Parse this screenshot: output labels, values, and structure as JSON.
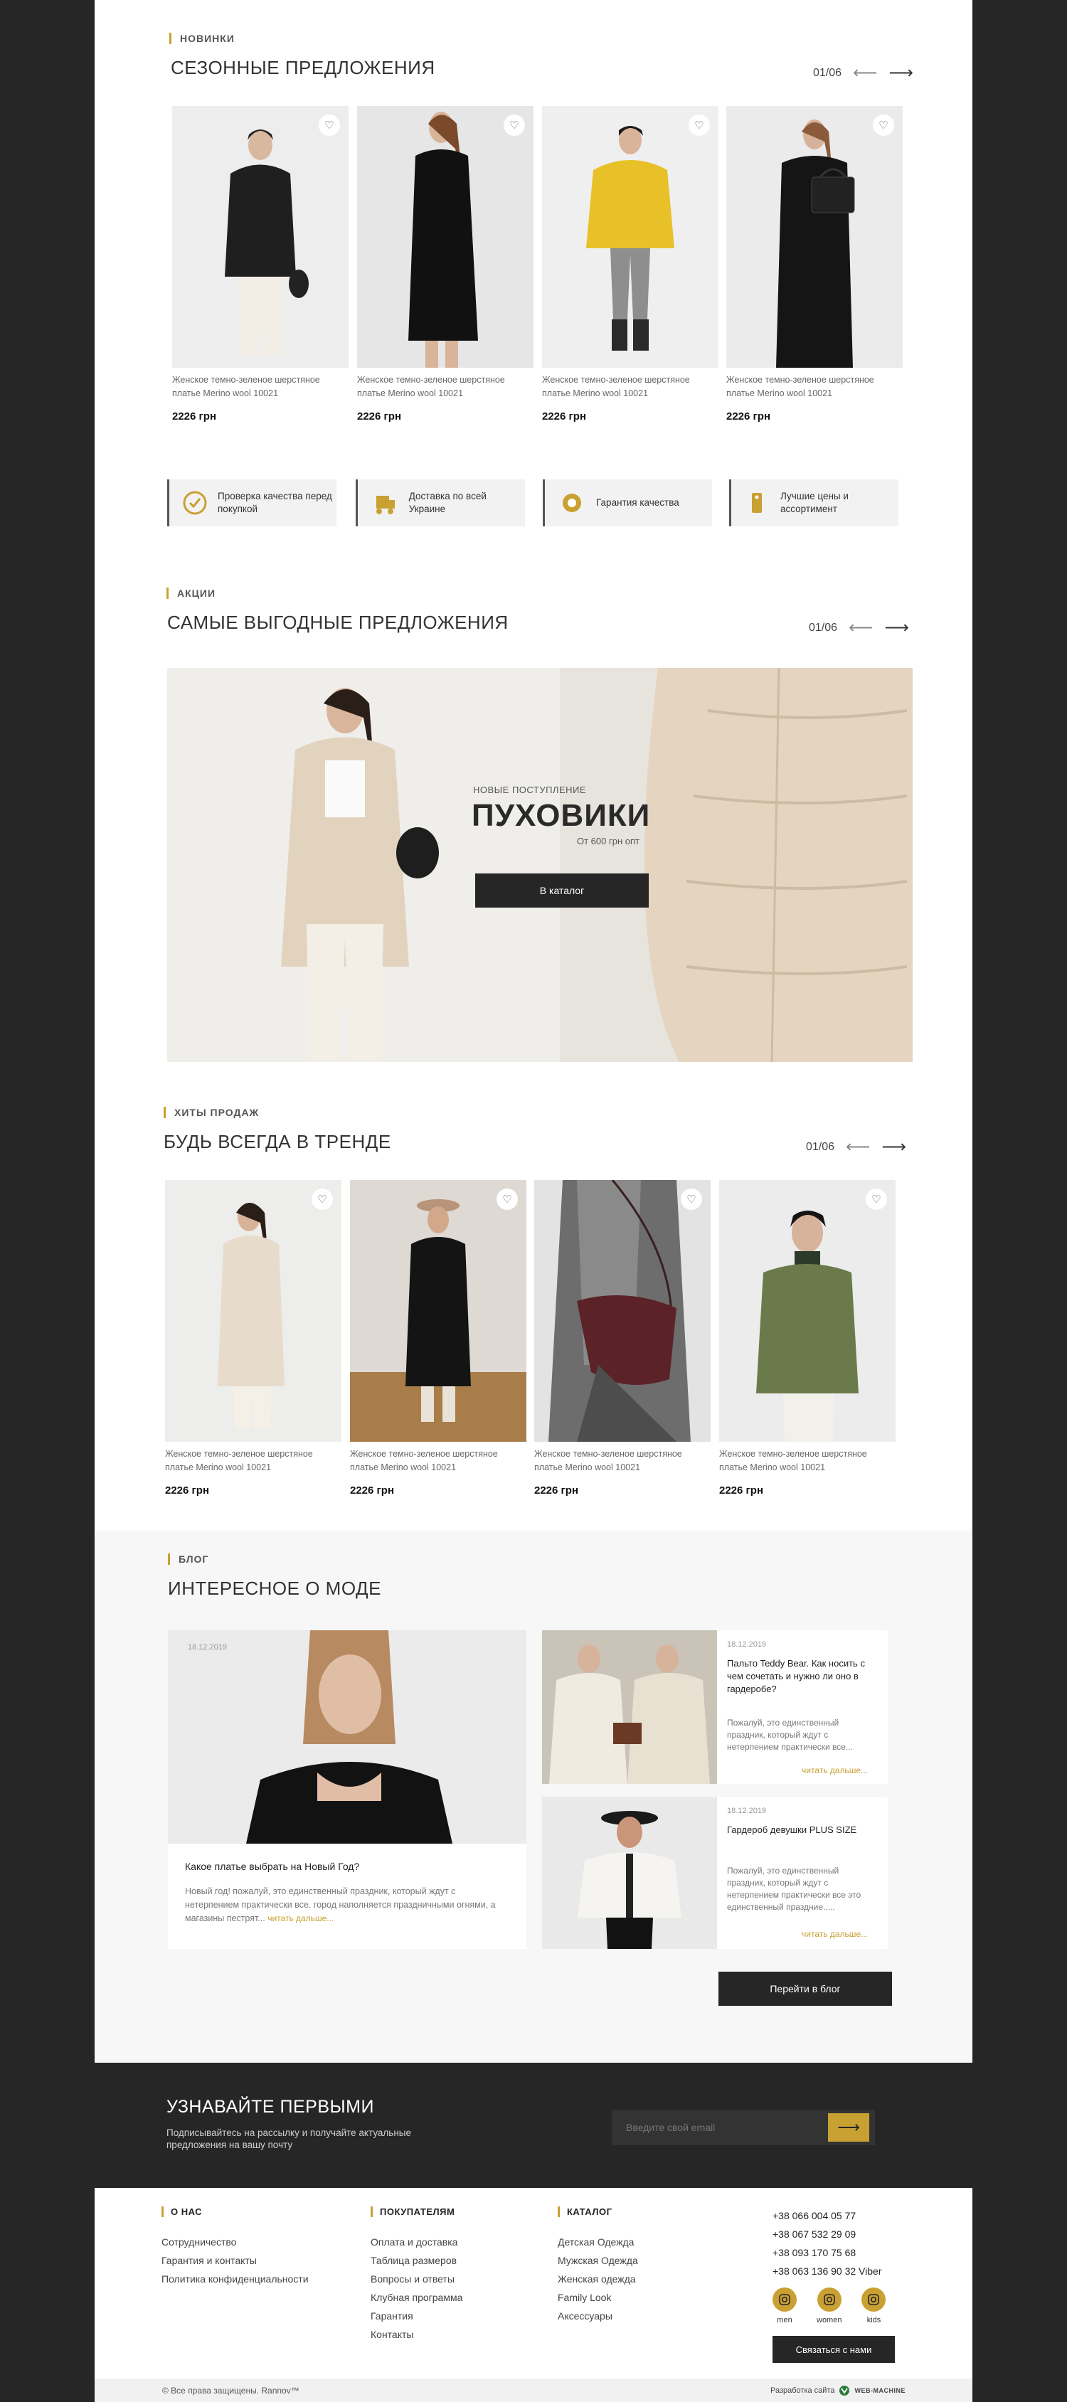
{
  "new_section": {
    "kicker": "НОВИНКИ",
    "title": "СЕЗОННЫЕ ПРЕДЛОЖЕНИЯ",
    "pager": "01/06",
    "products": [
      {
        "name": "Женское темно-зеленое шерстяное платье Merino wool 10021",
        "price": "2226 грн"
      },
      {
        "name": "Женское темно-зеленое шерстяное платье Merino wool 10021",
        "price": "2226 грн"
      },
      {
        "name": "Женское темно-зеленое шерстяное платье Merino wool 10021",
        "price": "2226 грн"
      },
      {
        "name": "Женское темно-зеленое шерстяное платье Merino wool 10021",
        "price": "2226 грн"
      }
    ]
  },
  "features": [
    {
      "label": "Проверка качества перед покупкой",
      "icon": "quality-check-icon"
    },
    {
      "label": "Доставка по всей Украине",
      "icon": "delivery-icon"
    },
    {
      "label": "Гарантия качества",
      "icon": "badge-icon"
    },
    {
      "label": "Лучшие цены и ассортимент",
      "icon": "price-tag-icon"
    }
  ],
  "promo_section": {
    "kicker": "АКЦИИ",
    "title": "САМЫЕ ВЫГОДНЫЕ ПРЕДЛОЖЕНИЯ",
    "pager": "01/06",
    "banner": {
      "overline": "НОВЫЕ ПОСТУПЛЕНИЕ",
      "headline": "ПУХОВИКИ",
      "subline": "От 600 грн опт",
      "button": "В каталог"
    }
  },
  "hits_section": {
    "kicker": "ХИТЫ ПРОДАЖ",
    "title": "БУДЬ ВСЕГДА В ТРЕНДЕ",
    "pager": "01/06",
    "products": [
      {
        "name": "Женское темно-зеленое шерстяное платье Merino wool 10021",
        "price": "2226 грн"
      },
      {
        "name": "Женское темно-зеленое шерстяное платье Merino wool 10021",
        "price": "2226 грн"
      },
      {
        "name": "Женское темно-зеленое шерстяное платье Merino wool 10021",
        "price": "2226 грн"
      },
      {
        "name": "Женское темно-зеленое шерстяное платье Merino wool 10021",
        "price": "2226 грн"
      }
    ]
  },
  "blog_section": {
    "kicker": "БЛОГ",
    "title": "ИНТЕРЕСНОЕ О МОДЕ",
    "main_post": {
      "date": "18.12.2019",
      "title": "Какое платье выбрать на Новый Год?",
      "excerpt": "Новый год! пожалуй, это единственный праздник, который ждут с нетерпением практически все. город наполняется праздничными огнями, а магазины пестрят...",
      "more": "читать дальше..."
    },
    "side_posts": [
      {
        "date": "18.12.2019",
        "title": "Пальто Teddy Bear. Как носить с чем сочетать и нужно ли оно в гардеробе?",
        "excerpt": "Пожалуй, это единственный праздник, который ждут с нетерпением практически все...",
        "more": "читать дальше..."
      },
      {
        "date": "18.12.2019",
        "title": "Гардероб девушки PLUS SIZE",
        "excerpt": "Пожалуй, это единственный праздник, который ждут с нетерпением практически все это единственный праздние.....",
        "more": "читать дальше..."
      }
    ],
    "button": "Перейти в блог"
  },
  "newsletter": {
    "title": "УЗНАВАЙТЕ ПЕРВЫМИ",
    "text": "Подписывайтесь на рассылку и получайте актуальные предложения на вашу почту",
    "placeholder": "Введите свой email"
  },
  "footer": {
    "about": {
      "title": "О НАС",
      "items": [
        "Сотрудничество",
        "Гарантия и контакты",
        "Политика конфиденциальности"
      ]
    },
    "buyers": {
      "title": "ПОКУПАТЕЛЯМ",
      "items": [
        "Оплата и доставка",
        "Таблица размеров",
        "Вопросы и ответы",
        "Клубная программа",
        "Гарантия",
        "Контакты"
      ]
    },
    "catalog": {
      "title": "КАТАЛОГ",
      "items": [
        "Детская Одежда",
        "Мужская Одежда",
        "Женская одежда",
        "Family Look",
        "Аксессуары"
      ]
    },
    "phones": [
      "+38 066 004 05 77",
      "+38 067 532 29 09",
      "+38 093 170 75 68",
      "+38 063 136 90 32 Viber"
    ],
    "socials": [
      {
        "label": "men"
      },
      {
        "label": "women"
      },
      {
        "label": "kids"
      }
    ],
    "contact_button": "Связаться с нами",
    "copyright": "© Все права защищены. Rannov™",
    "dev_label": "Разработка сайта",
    "dev_brand": "WEB-MACHINE"
  },
  "colors": {
    "accent": "#c9a032",
    "dark": "#262626",
    "light_bg": "#f7f7f7"
  }
}
